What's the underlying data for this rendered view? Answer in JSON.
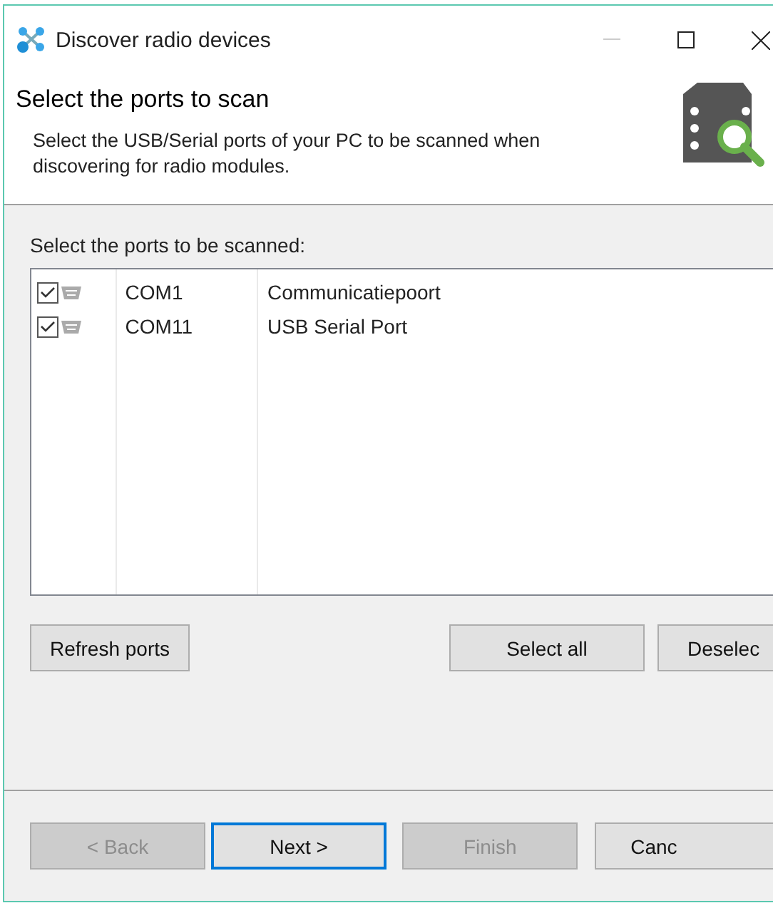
{
  "window": {
    "title": "Discover radio devices"
  },
  "header": {
    "title": "Select the ports to scan",
    "description": "Select the USB/Serial ports of your PC to be scanned when discovering for radio modules."
  },
  "ports_label": "Select the ports to be scanned:",
  "ports": [
    {
      "checked": true,
      "name": "COM1",
      "description": "Communicatiepoort"
    },
    {
      "checked": true,
      "name": "COM11",
      "description": "USB Serial Port"
    }
  ],
  "list_buttons": [
    {
      "label": "Refresh ports"
    },
    {
      "label": "Select all"
    },
    {
      "label": "Deselec"
    }
  ],
  "nav_buttons": [
    {
      "label": "< Back",
      "disabled": true,
      "focused": false
    },
    {
      "label": "Next >",
      "disabled": false,
      "focused": true
    },
    {
      "label": "Finish",
      "disabled": true,
      "focused": false
    },
    {
      "label": "Canc",
      "disabled": false,
      "focused": false
    }
  ]
}
